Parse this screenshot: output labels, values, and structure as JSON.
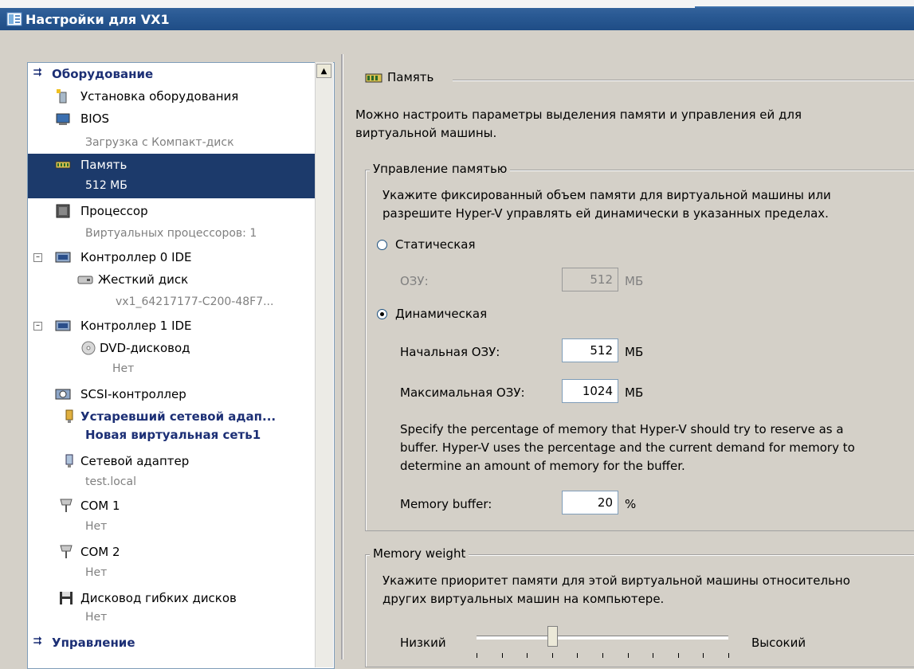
{
  "window": {
    "title": "Настройки для VX1"
  },
  "tree": {
    "hardware_section": "Оборудование",
    "items": [
      {
        "label": "Установка оборудования"
      },
      {
        "label": "BIOS",
        "sub": "Загрузка с Компакт-диск"
      },
      {
        "label": "Память",
        "sub": "512 МБ",
        "selected": true
      },
      {
        "label": "Процессор",
        "sub": "Виртуальных процессоров: 1"
      },
      {
        "label": "Контроллер 0 IDE"
      },
      {
        "label": "Жесткий диск",
        "sub": "vx1_64217177-C200-48F7..."
      },
      {
        "label": "Контроллер 1 IDE"
      },
      {
        "label": "DVD-дисковод",
        "sub": "Нет"
      },
      {
        "label": "SCSI-контроллер"
      },
      {
        "label": "Устаревший сетевой адап...",
        "sub": "Новая виртуальная сеть1"
      },
      {
        "label": "Сетевой адаптер",
        "sub": "test.local"
      },
      {
        "label": "COM 1",
        "sub": "Нет"
      },
      {
        "label": "COM 2",
        "sub": "Нет"
      },
      {
        "label": "Дисковод гибких дисков",
        "sub": "Нет"
      }
    ],
    "management_section": "Управление"
  },
  "memory": {
    "title": "Память",
    "description_1": "Можно настроить параметры выделения памяти и управления ей для",
    "description_2": "виртуальной машины.",
    "mgmt_group": "Управление памятью",
    "mgmt_desc_1": "Укажите фиксированный объем памяти для виртуальной машины или",
    "mgmt_desc_2": "разрешите Hyper-V  управлять ей динамически в указанных пределах.",
    "static_label": "Статическая",
    "ram_label": "ОЗУ:",
    "ram_value": "512",
    "mb": "МБ",
    "dynamic_label": "Динамическая",
    "start_ram_label": "Начальная ОЗУ:",
    "start_ram_value": "512",
    "max_ram_label": "Максимальная ОЗУ:",
    "max_ram_value": "1024",
    "buffer_desc_1": "Specify the percentage of memory that Hyper-V should try to reserve as a",
    "buffer_desc_2": "buffer. Hyper-V uses the percentage and the current demand for memory to",
    "buffer_desc_3": "determine an amount of memory for the buffer.",
    "buffer_label": "Memory buffer:",
    "buffer_value": "20",
    "percent": "%",
    "weight_group": "Memory weight",
    "weight_desc_1": "Укажите приоритет памяти для этой виртуальной машины относительно",
    "weight_desc_2": "других виртуальных машин на компьютере.",
    "low_label": "Низкий",
    "high_label": "Высокий",
    "weight_level": 0.3
  },
  "colors": {
    "selection": "#1c3a6b",
    "title_bar": "#2a5a94",
    "section": "#1c2f75"
  }
}
